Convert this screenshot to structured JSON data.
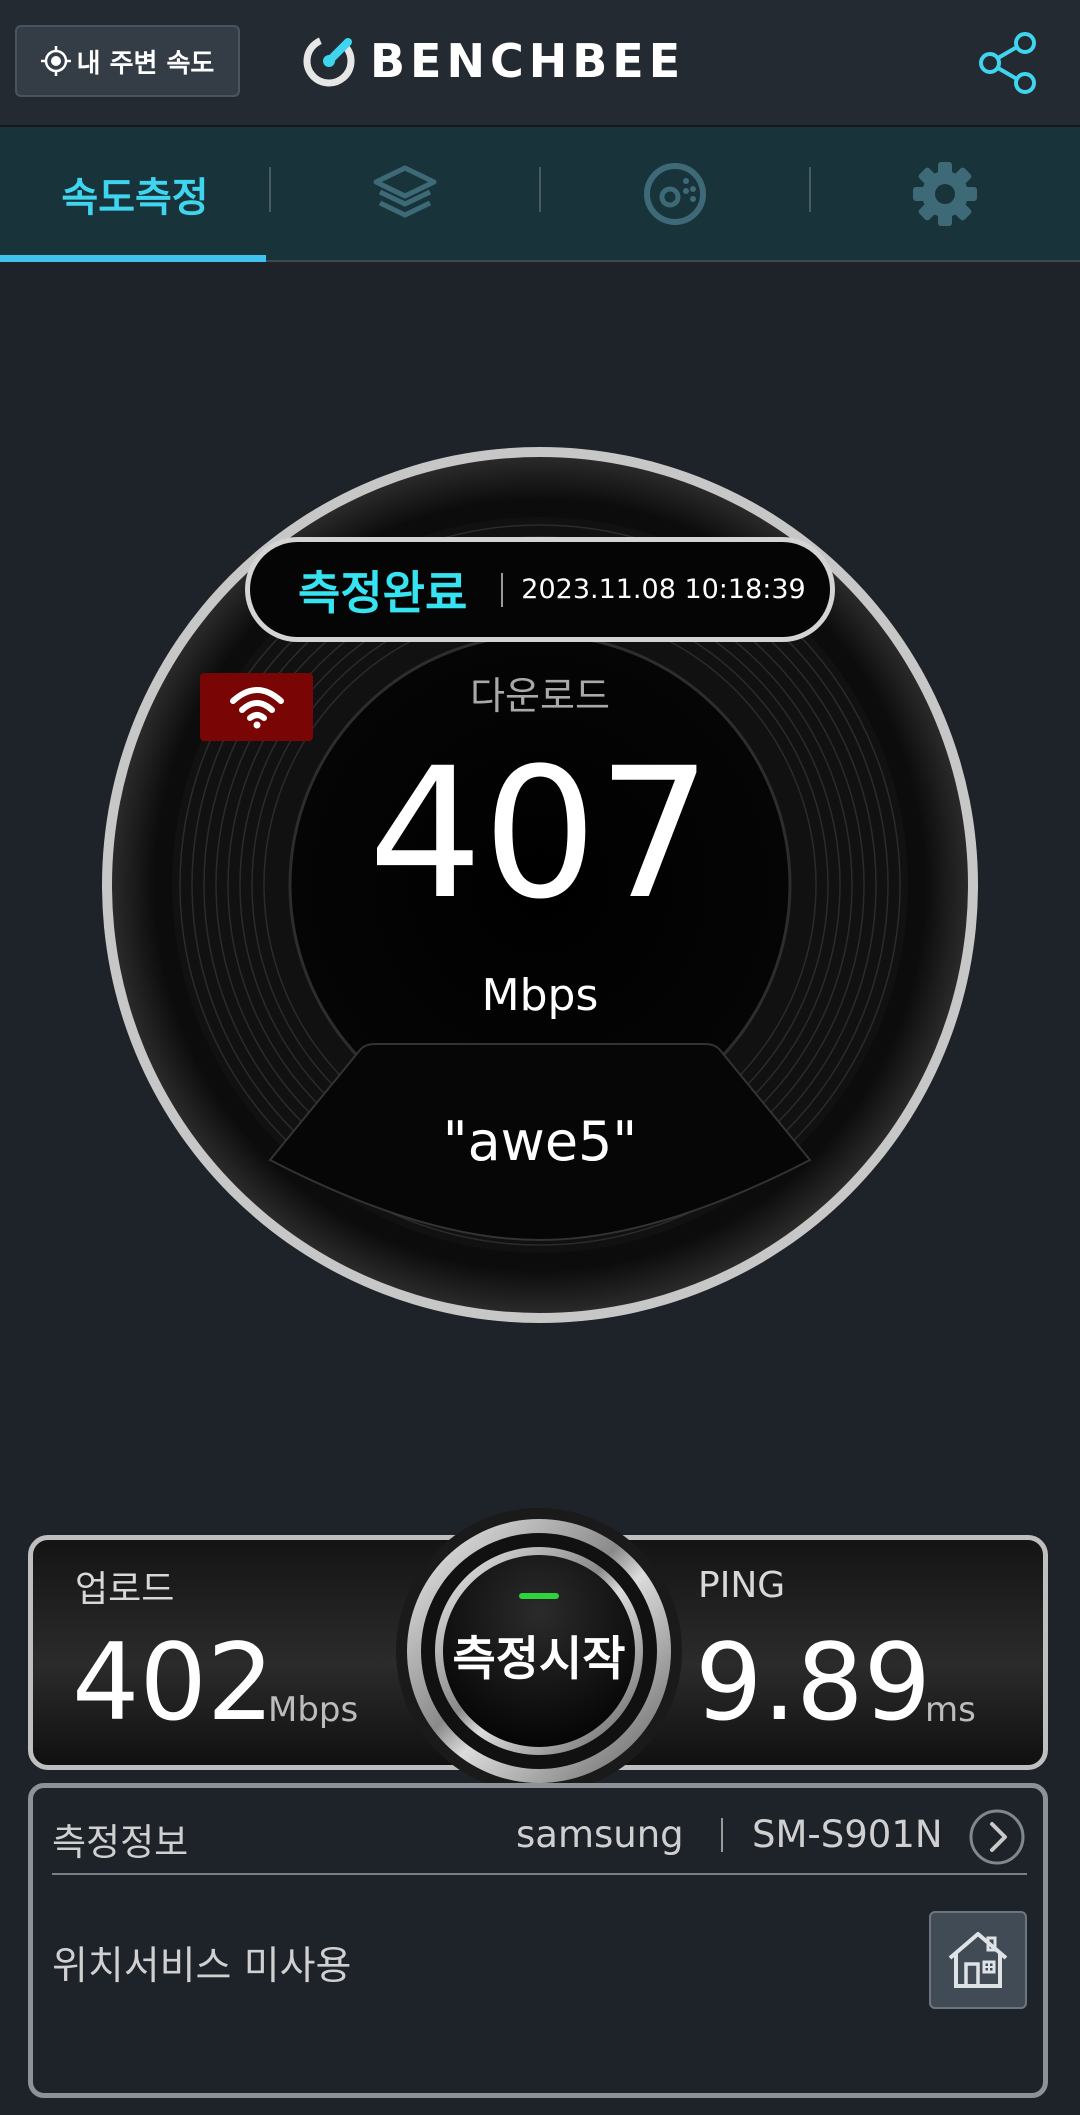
{
  "header": {
    "nearby_label": "내 주변 속도",
    "logo_text": "BENCHBEE"
  },
  "tabs": [
    {
      "label": "속도측정",
      "icon": "speed-test",
      "active": true
    },
    {
      "label": "",
      "icon": "layers-icon",
      "active": false
    },
    {
      "label": "",
      "icon": "disc-stats-icon",
      "active": false
    },
    {
      "label": "",
      "icon": "gear-icon",
      "active": false
    }
  ],
  "measurement": {
    "status": "측정완료",
    "datetime": "2023.11.08 10:18:39",
    "download_label": "다운로드",
    "download_value": "407",
    "download_unit": "Mbps",
    "network_name": "\"awe5\"",
    "connection_icon": "wifi-icon"
  },
  "results": {
    "upload_label": "업로드",
    "upload_value": "402",
    "upload_unit": "Mbps",
    "ping_label": "PING",
    "ping_value": "9.89",
    "ping_unit": "ms",
    "start_label": "측정시작"
  },
  "info": {
    "title": "측정정보",
    "brand": "samsung",
    "model": "SM-S901N",
    "location_status": "위치서비스 미사용"
  },
  "colors": {
    "accent_cyan": "#3fd5ee",
    "status_cyan": "#36e3f0",
    "wifi_badge": "#7a0505",
    "start_led": "#2fd33a",
    "background": "#1e232a"
  }
}
